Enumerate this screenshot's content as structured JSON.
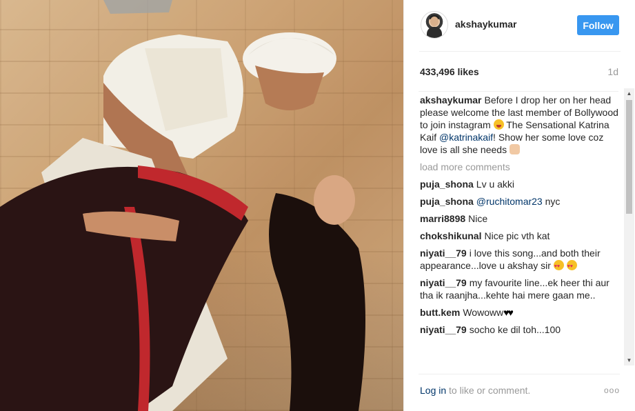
{
  "post": {
    "username": "akshaykumar",
    "follow_label": "Follow",
    "likes": "433,496 likes",
    "age": "1d",
    "caption": {
      "user": "akshaykumar",
      "text1": "Before I drop her on her head please welcome the last member of Bollywood to join instagram",
      "text2": "The Sensational Katrina Kaif",
      "mention": "@katrinakaif",
      "text3": "! Show her some love coz love is all she needs"
    },
    "load_more": "load more comments",
    "comments": [
      {
        "user": "puja_shona",
        "text": "Lv u akki"
      },
      {
        "user": "puja_shona",
        "mention": "@ruchitomar23",
        "text": "nyc"
      },
      {
        "user": "marri8898",
        "text": "Nice"
      },
      {
        "user": "chokshikunal",
        "text": "Nice pic vth kat"
      },
      {
        "user": "niyati__79",
        "text": "i love this song...and both their appearance...love u akshay sir"
      },
      {
        "user": "niyati__79",
        "text": "my favourite line...ek heer thi aur tha ik raanjha...kehte hai mere gaan me.."
      },
      {
        "user": "butt.kem",
        "text": "Wowoww",
        "hearts": "♥♥"
      },
      {
        "user": "niyati__79",
        "text": "socho ke dil toh...100"
      }
    ],
    "footer": {
      "login": "Log in",
      "rest": " to like or comment.",
      "more": "ooo"
    }
  }
}
